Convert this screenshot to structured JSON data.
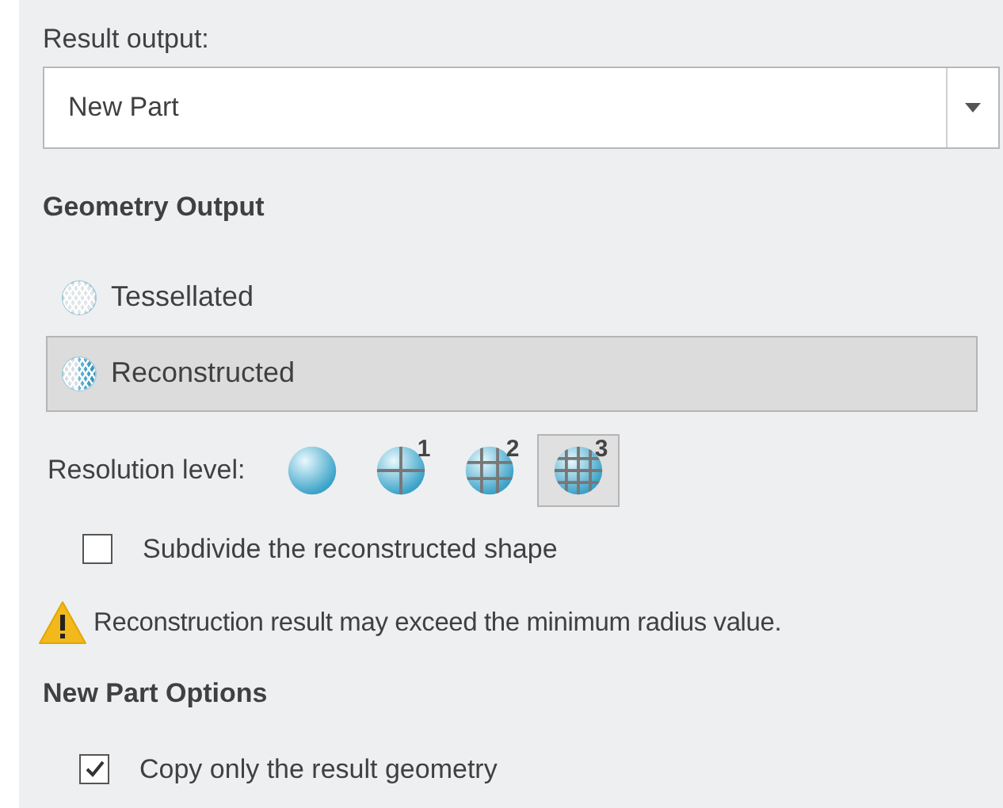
{
  "result_output": {
    "label": "Result output:",
    "value": "New Part"
  },
  "geometry_output": {
    "heading": "Geometry Output",
    "options": [
      {
        "label": "Tessellated",
        "kind": "tessellated",
        "selected": false
      },
      {
        "label": "Reconstructed",
        "kind": "reconstructed",
        "selected": true
      }
    ]
  },
  "resolution": {
    "label": "Resolution level:",
    "levels": [
      {
        "kind": "smooth",
        "selected": false
      },
      {
        "kind": "coarse",
        "badge": "1",
        "selected": false
      },
      {
        "kind": "medium",
        "badge": "2",
        "selected": false
      },
      {
        "kind": "fine",
        "badge": "3",
        "selected": true
      }
    ]
  },
  "subdivide": {
    "label": "Subdivide the reconstructed shape",
    "checked": false
  },
  "warning": "Reconstruction result may exceed the minimum radius value.",
  "new_part_options": {
    "heading": "New Part Options",
    "copy_only": {
      "label": "Copy only the result geometry",
      "checked": true
    }
  }
}
